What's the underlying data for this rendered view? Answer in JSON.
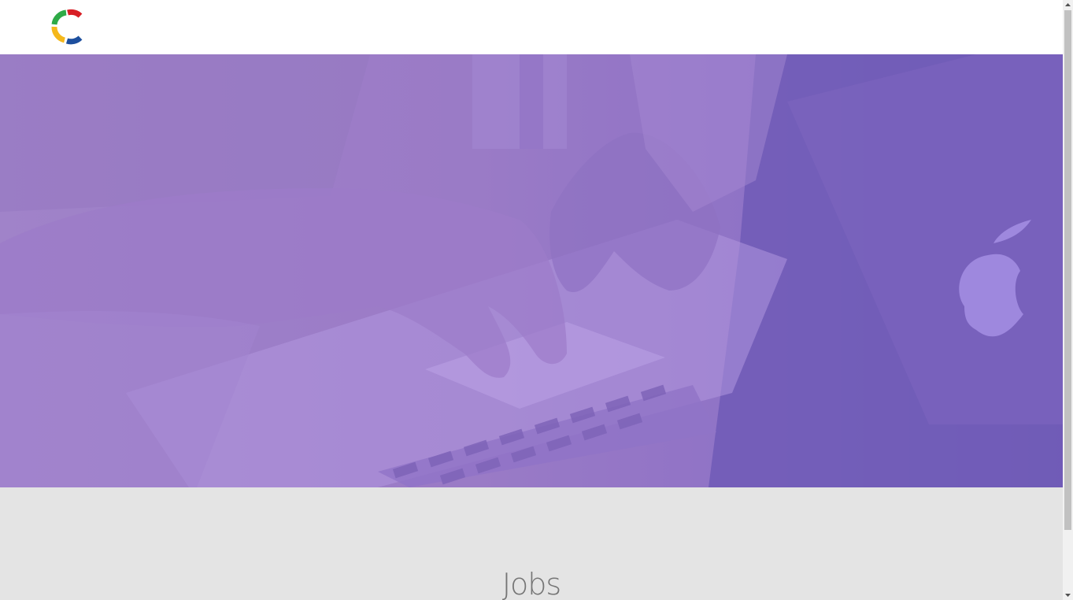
{
  "header": {
    "logo_icon": "c-logo-icon",
    "logo_colors": [
      "#2eaa47",
      "#d81f26",
      "#f5b81b",
      "#1d4f9e"
    ]
  },
  "hero": {
    "image": "hands-typing-on-laptop-photo",
    "overlay_color": "#9b7fd4"
  },
  "section": {
    "title": "Jobs"
  },
  "scrollbar": {
    "up_icon": "arrow-up-icon",
    "down_icon": "arrow-down-icon"
  }
}
